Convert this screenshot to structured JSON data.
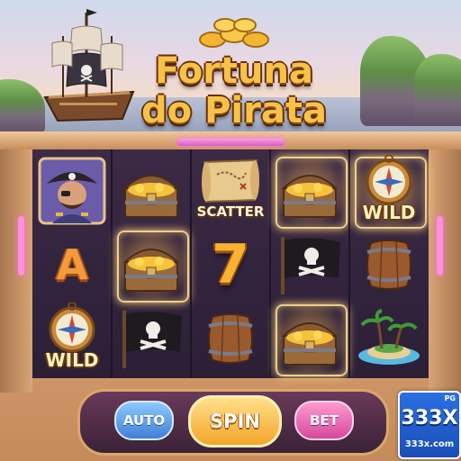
{
  "title": {
    "line1": "Fortuna",
    "line2": "do Pirata"
  },
  "reels": [
    [
      {
        "symbol": "pirate-captain"
      },
      {
        "symbol": "letter",
        "text": "A"
      },
      {
        "symbol": "compass-wild",
        "text": "WILD"
      }
    ],
    [
      {
        "symbol": "treasure-chest"
      },
      {
        "symbol": "treasure-chest",
        "highlighted": true
      },
      {
        "symbol": "pirate-flag"
      }
    ],
    [
      {
        "symbol": "map-scatter",
        "text": "SCATTER"
      },
      {
        "symbol": "seven",
        "text": "7"
      },
      {
        "symbol": "barrel"
      }
    ],
    [
      {
        "symbol": "treasure-chest",
        "highlighted": true
      },
      {
        "symbol": "pirate-flag"
      },
      {
        "symbol": "treasure-chest",
        "highlighted": true
      }
    ],
    [
      {
        "symbol": "compass-wild",
        "text": "WILD",
        "highlighted": true
      },
      {
        "symbol": "barrel"
      },
      {
        "symbol": "island"
      }
    ]
  ],
  "controls": {
    "auto_label": "AUTO",
    "spin_label": "SPIN",
    "bet_label": "BET"
  },
  "brand": {
    "top": "PG",
    "name": "333X",
    "site": "333x.com"
  },
  "colors": {
    "title_gold": "#f6c24a",
    "spin_button": "#f2a52a",
    "auto_button": "#3f7fd6",
    "bet_button": "#d6489c",
    "brand_blue": "#2b6fe0",
    "reel_background": "#3c2a45"
  }
}
